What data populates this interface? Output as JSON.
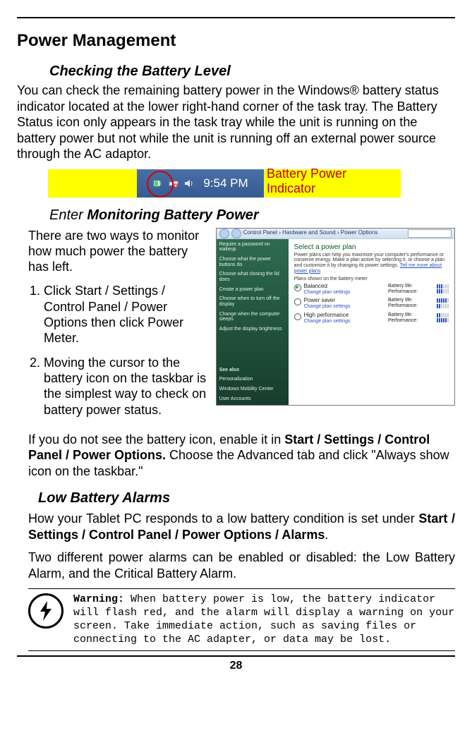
{
  "page_number": "28",
  "h1": "Power Management",
  "h2_checking": "Checking the Battery Level",
  "p_checking": "You can check the remaining battery power in the Windows® battery status indicator located at the lower right-hand corner of the task tray. The Battery Status icon only appears in the task tray while the unit is running on the battery power but not while the unit is running off an external power source through the AC adaptor.",
  "tray": {
    "time": "9:54 PM",
    "indicator_label": "Battery Power Indicator"
  },
  "h2_enter_prefix": "Enter ",
  "h2_enter_bold": "Monitoring Battery Power",
  "monitor_intro": "There are two ways to monitor how much power the battery has left.",
  "steps": [
    "Click Start / Settings / Control Panel / Power Options then click Power Meter.",
    "Moving the cursor to the battery icon on the taskbar is the simplest way to check on battery power status."
  ],
  "enable_line_pre": "If you do not see the battery icon, enable it in ",
  "enable_line_bold": "Start / Settings / Control Panel / Power Options.",
  "enable_line_post": " Choose the Advanced tab and click \"Always show icon on the taskbar.\"",
  "h2_low": "Low Battery Alarms",
  "low_p1_pre": "How your Tablet PC responds to a low battery condition is set under ",
  "low_p1_bold": "Start / Settings / Control Panel / Power Options / Alarms",
  "low_p1_post": ".",
  "low_p2": "Two different power alarms can be enabled or disabled: the Low Battery Alarm, and the Critical Battery Alarm.",
  "warning_label": "Warning:",
  "warning_body": " When battery power is low, the battery indicator will flash red, and the alarm will display a warning on your screen. Take immediate action, such as saving files or connecting to the AC adapter, or data may be lost.",
  "screenshot": {
    "breadcrumb": "Control Panel  ›  Hardware and Sound  ›  Power Options",
    "search_placeholder": "Search",
    "sidebar": [
      "Require a password on wakeup",
      "Choose what the power buttons do",
      "Choose what closing the lid does",
      "Create a power plan",
      "Choose when to turn off the display",
      "Change when the computer sleeps",
      "Adjust the display brightness"
    ],
    "sidebar_seealso": "See also",
    "sidebar_seealso_items": [
      "Personalization",
      "Windows Mobility Center",
      "User Accounts"
    ],
    "title": "Select a power plan",
    "desc": "Power plans can help you maximize your computer's performance or conserve energy. Make a plan active by selecting it, or choose a plan and customize it by changing its power settings. ",
    "desc_link": "Tell me more about power plans",
    "shown_label": "Plans shown on the battery meter",
    "change_link": "Change plan settings",
    "battery_label": "Battery life:",
    "perf_label": "Performance:",
    "plans": [
      {
        "name": "Balanced",
        "selected": true,
        "batt": 3,
        "perf": 3
      },
      {
        "name": "Power saver",
        "selected": false,
        "batt": 5,
        "perf": 2
      },
      {
        "name": "High performance",
        "selected": false,
        "batt": 2,
        "perf": 5
      }
    ]
  }
}
